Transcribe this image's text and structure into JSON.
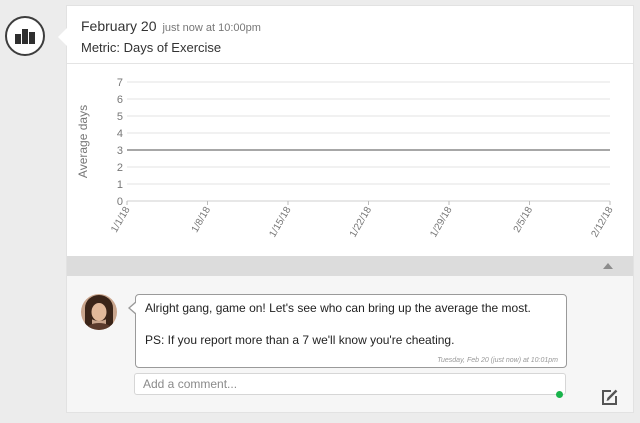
{
  "header": {
    "date": "February 20",
    "time": "just now at 10:00pm",
    "metric": "Metric: Days of Exercise"
  },
  "icons": {
    "app_logo": "bar-chart-logo-icon",
    "collapse": "caret-up-icon",
    "edit": "edit-note-icon"
  },
  "chart_data": {
    "type": "line",
    "ylabel": "Average days",
    "xlabel": "",
    "ylim": [
      0,
      7
    ],
    "yticks": [
      0,
      1,
      2,
      3,
      4,
      5,
      6,
      7
    ],
    "x": [
      "1/1/18",
      "1/8/18",
      "1/15/18",
      "1/22/18",
      "1/29/18",
      "2/5/18",
      "2/12/18"
    ],
    "series": [
      {
        "values": [
          3,
          3,
          3,
          3,
          3,
          3,
          3
        ],
        "color": "#8a8a8a"
      }
    ],
    "grid": true
  },
  "comment": {
    "line1": "Alright gang, game on! Let's see who can bring up the average the most.",
    "line2": "PS: If you report more than a 7 we'll know you're cheating.",
    "meta": "Tuesday, Feb 20 (just now) at 10:01pm"
  },
  "comment_input": {
    "placeholder": "Add a comment..."
  },
  "colors": {
    "online": "#19b34b",
    "grid": "#e3e3e3",
    "series": "#8a8a8a"
  }
}
